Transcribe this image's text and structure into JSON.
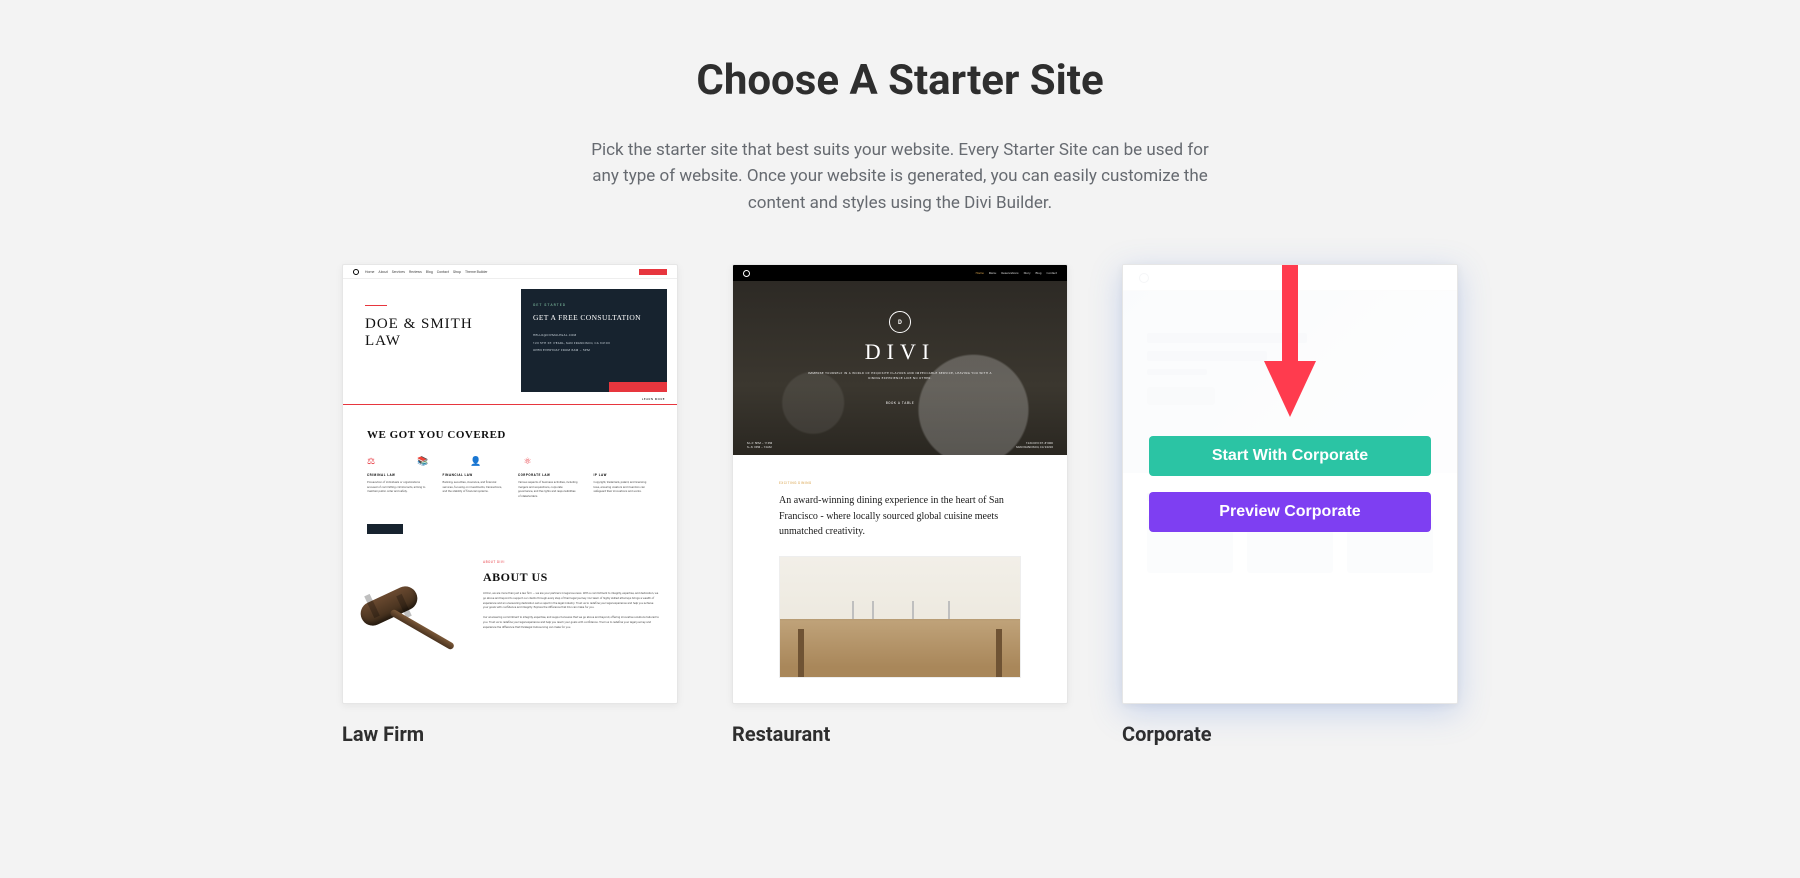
{
  "heading": "Choose A Starter Site",
  "description": "Pick the starter site that best suits your website. Every Starter Site can be used for any type of website. Once your website is generated, you can easily customize the content and styles using the Divi Builder.",
  "cards": {
    "law": {
      "title": "Law Firm",
      "nav": [
        "Home",
        "About",
        "Services",
        "Reviews",
        "Blog",
        "Contact",
        "Shop",
        "Theme Builder"
      ],
      "hero_title_line1": "DOE & SMITH",
      "hero_title_line2": "LAW",
      "consult_eyebrow": "GET STARTED",
      "consult_title": "GET A FREE CONSULTATION",
      "consult_lines": [
        "HELLO@DIVMALEGAL.COM",
        "123 5TH ST. PEARL, SAN FRANCISCO, CA 94103",
        "OPEN EVERYDAY FROM 8AM – 5PM"
      ],
      "learn_more": "LEARN MORE",
      "covered_heading": "WE GOT YOU COVERED",
      "columns": [
        {
          "heading": "CRIMINAL LAW",
          "text": "Prosecution of individuals or organizations accused of committing criminal acts, aiming to maintain public order and safety."
        },
        {
          "heading": "FINANCIAL LAW",
          "text": "Banking, securities, insurance, and financial services, focusing on investments, transactions, and the stability of financial systems."
        },
        {
          "heading": "CORPORATE LAW",
          "text": "Various aspects of business activities, including mergers and acquisitions, corporate governance, and the rights and responsibilities of stakeholders."
        },
        {
          "heading": "IP LAW",
          "text": "Copyright, trademark, patent, and licensing laws, ensuring creators and inventors can safeguard their innovations and works."
        }
      ],
      "about_eyebrow": "ABOUT DIVI",
      "about_heading": "ABOUT US",
      "about_p1": "At Divi, we are more than just a law firm — we are your partners in legal success. With a commitment to integrity, expertise, and dedication, we go above and beyond to support our clients through every step of their legal journey. Our team of highly skilled attorneys brings a wealth of experience and an unwavering dedication set us apart in the legal industry. Trust us to redefine your legal experience and help you achieve your goals with confidence and integrity. Explore the difference that Divi can make for you.",
      "about_p2": "Our unwavering commitment to integrity, expertise, and support ensures that we go above and beyond, offering innovative solutions tailored to you. Trust us to redefine your legal experience and help you reach your goals with confidence. Trust us to redefine your legal journey and experience the difference that Paralegal Outsourcing can make for you."
    },
    "restaurant": {
      "title": "Restaurant",
      "nav": [
        "Home",
        "Menu",
        "Reservations",
        "Story",
        "Blog",
        "Contact"
      ],
      "brand": "DIVI",
      "tagline": "IMMERSE YOURSELF IN A WORLD OF EXQUISITE FLAVORS AND IMPECCABLE SERVICE, LEAVING YOU WITH A DINING EXPERIENCE LIKE NO OTHER.",
      "book": "BOOK A TABLE",
      "hours": "M–F: 5PM – 11PM\nS–S: 3PM – 12AM",
      "address": "1234 DIVI ST. #1000\nSAN FRANCISCO, CA 94220",
      "body_eyebrow": "EXCITING DINING",
      "body_text": "An award-winning dining experience in the heart of San Francisco - where locally sourced global cuisine meets unmatched creativity."
    },
    "corporate": {
      "title": "Corporate",
      "start_label": "Start With Corporate",
      "preview_label": "Preview Corporate"
    }
  },
  "colors": {
    "accent_green": "#2bc4a4",
    "accent_purple": "#7e3ff2",
    "annotation_red": "#ff3b4e"
  }
}
